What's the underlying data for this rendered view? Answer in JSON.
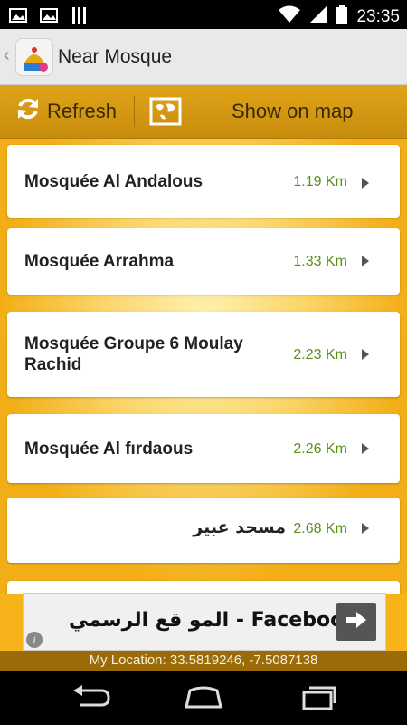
{
  "status_bar": {
    "time": "23:35"
  },
  "app_bar": {
    "title": "Near Mosque"
  },
  "toolbar": {
    "refresh_label": "Refresh",
    "show_on_map_label": "Show on map"
  },
  "mosques": [
    {
      "name": "Mosquée Al Andalous",
      "distance": "1.19 Km"
    },
    {
      "name": "Mosquée Arrahma",
      "distance": "1.33 Km"
    },
    {
      "name": "Mosquée Groupe 6 Moulay Rachid",
      "distance": "2.23 Km"
    },
    {
      "name": "Mosquée Al fırdaous",
      "distance": "2.26 Km"
    },
    {
      "name": "مسجد عبير",
      "distance": "2.68 Km"
    }
  ],
  "ad": {
    "text": "المو قع الرسمي - Facebook"
  },
  "footer": {
    "location": "My Location: 33.5819246, -7.5087138"
  }
}
